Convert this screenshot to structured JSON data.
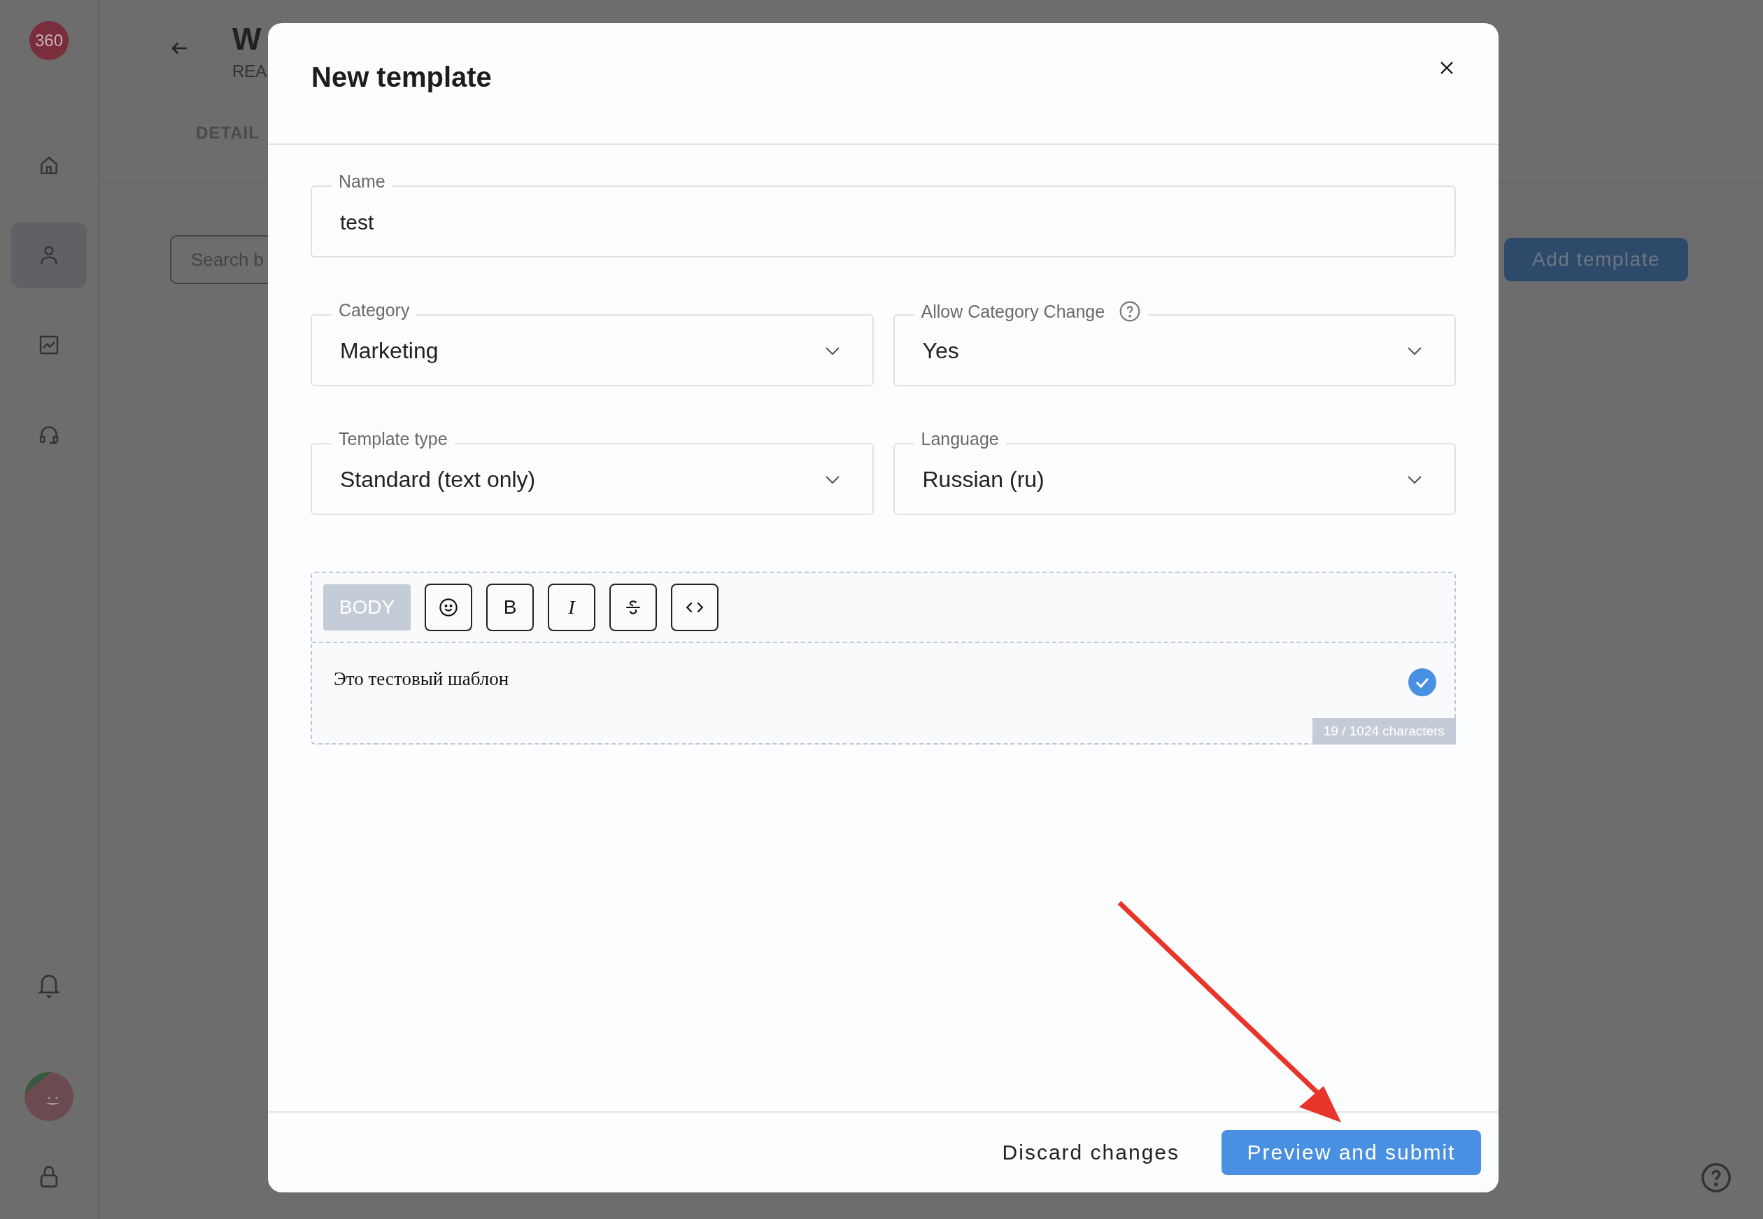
{
  "sidebar": {
    "logo": "360",
    "items": [
      {
        "kind": "home",
        "selected": false
      },
      {
        "kind": "person",
        "selected": true
      },
      {
        "kind": "chart",
        "selected": false
      },
      {
        "kind": "headset",
        "selected": false
      }
    ]
  },
  "page": {
    "title": "W",
    "subtitle": "REA",
    "tab": "DETAIL",
    "search": {
      "placeholder": "Search b"
    },
    "add_button": "Add template"
  },
  "modal": {
    "title": "New template",
    "fields": [
      {
        "label": "Name",
        "value": "test",
        "kind": "text",
        "help": false
      },
      {
        "label": "Category",
        "value": "Marketing",
        "kind": "select",
        "help": false
      },
      {
        "label": "Allow Category Change",
        "value": "Yes",
        "kind": "select",
        "help": true
      },
      {
        "label": "Template type",
        "value": "Standard (text only)",
        "kind": "select",
        "help": false
      },
      {
        "label": "Language",
        "value": "Russian (ru)",
        "kind": "select",
        "help": false
      }
    ],
    "editor": {
      "section": "BODY",
      "tools": [
        {
          "kind": "emoji"
        },
        {
          "kind": "letter",
          "label": "B",
          "italic": false
        },
        {
          "kind": "letter",
          "label": "I",
          "italic": true
        },
        {
          "kind": "strike"
        },
        {
          "kind": "code"
        }
      ],
      "text": "Это тестовый шаблон",
      "valid": true,
      "counter": "19 / 1024 characters"
    },
    "buttons": [
      {
        "label": "Discard changes",
        "kind": "text"
      },
      {
        "label": "Preview and submit",
        "kind": "primary"
      }
    ]
  }
}
